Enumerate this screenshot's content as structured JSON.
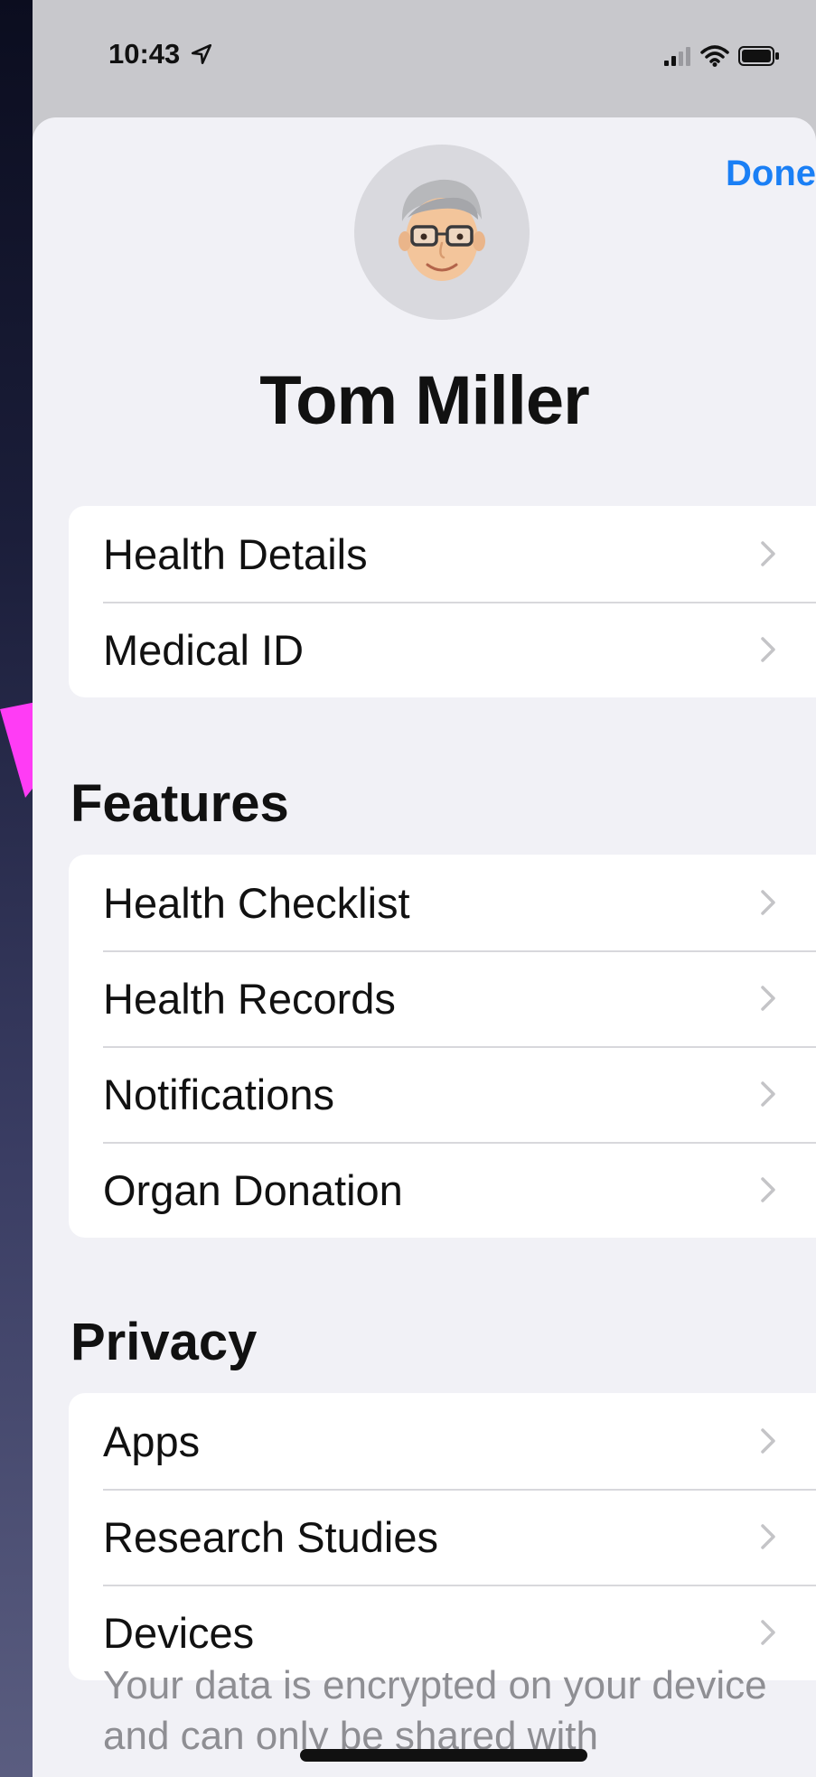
{
  "status_bar": {
    "time": "10:43",
    "icons": [
      "location-arrow-icon",
      "cellular-signal-icon",
      "wifi-icon",
      "battery-icon"
    ]
  },
  "header": {
    "done_label": "Done"
  },
  "profile": {
    "name": "Tom Miller"
  },
  "profile_items": [
    {
      "label": "Health Details"
    },
    {
      "label": "Medical ID"
    }
  ],
  "features": {
    "title": "Features",
    "items": [
      {
        "label": "Health Checklist"
      },
      {
        "label": "Health Records"
      },
      {
        "label": "Notifications"
      },
      {
        "label": "Organ Donation"
      }
    ]
  },
  "privacy": {
    "title": "Privacy",
    "items": [
      {
        "label": "Apps"
      },
      {
        "label": "Research Studies"
      },
      {
        "label": "Devices"
      }
    ]
  },
  "footer": {
    "text": "Your data is encrypted on your device and can only be shared with"
  },
  "colors": {
    "accent": "#1a7ff5",
    "annotation_arrow": "#ff3cf5",
    "sheet_background": "#f1f1f6"
  }
}
